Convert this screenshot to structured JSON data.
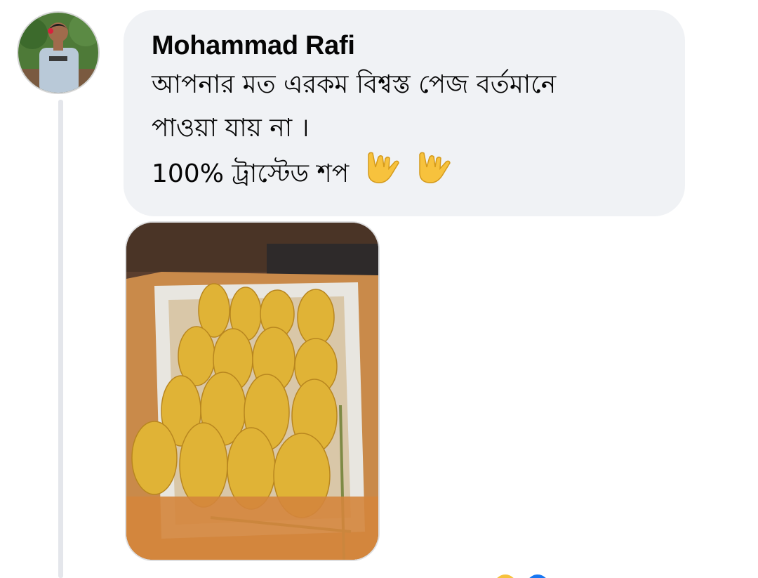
{
  "comment": {
    "author": "Mohammad Rafi",
    "lines": [
      "আপনার মত এরকম বিশ্বস্ত পেজ বর্তমানে",
      "পাওয়া যায় না ।",
      "100% ট্রাস্টেড শপ"
    ],
    "emojis": [
      "love-you-gesture-icon",
      "love-you-gesture-icon"
    ]
  },
  "colors": {
    "bubble": "#f0f2f5",
    "text": "#050505",
    "thread_line": "#e4e6eb",
    "emoji": "#f7c23d"
  }
}
